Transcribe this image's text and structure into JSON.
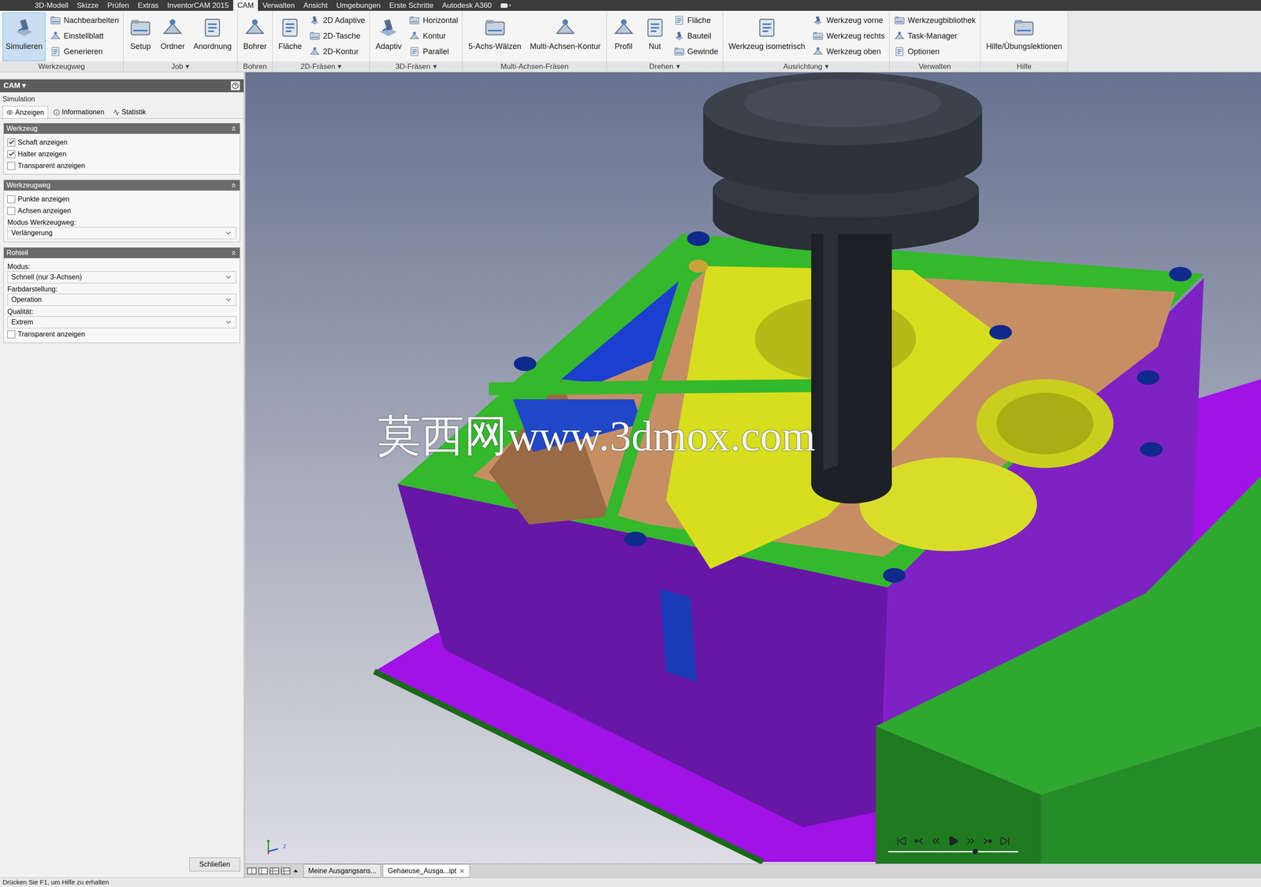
{
  "menu_tabs": [
    {
      "label": "3D-Modell",
      "selected": false
    },
    {
      "label": "Skizze",
      "selected": false
    },
    {
      "label": "Prüfen",
      "selected": false
    },
    {
      "label": "Extras",
      "selected": false
    },
    {
      "label": "InventorCAM 2015",
      "selected": false
    },
    {
      "label": "CAM",
      "selected": true
    },
    {
      "label": "Verwalten",
      "selected": false
    },
    {
      "label": "Ansicht",
      "selected": false
    },
    {
      "label": "Umgebungen",
      "selected": false
    },
    {
      "label": "Erste Schritte",
      "selected": false
    },
    {
      "label": "Autodesk A360",
      "selected": false
    }
  ],
  "dropdown_glyph": "▾",
  "ribbon_groups": [
    {
      "label": "Werkzeugweg",
      "dropdown": false,
      "columns": [
        {
          "kind": "large",
          "items": [
            {
              "label": "Simulieren",
              "selected": true
            }
          ]
        },
        {
          "kind": "stack",
          "items": [
            {
              "label": "Nachbearbeiten",
              "selected": false
            },
            {
              "label": "Einstellblatt",
              "selected": false
            },
            {
              "label": "Generieren",
              "selected": false
            }
          ]
        }
      ]
    },
    {
      "label": "Job",
      "dropdown": true,
      "columns": [
        {
          "kind": "large",
          "items": [
            {
              "label": "Setup",
              "selected": false
            }
          ]
        },
        {
          "kind": "large",
          "items": [
            {
              "label": "Ordner",
              "selected": false
            }
          ]
        },
        {
          "kind": "large",
          "items": [
            {
              "label": "Anordnung",
              "selected": false
            }
          ]
        }
      ]
    },
    {
      "label": "Bohren",
      "dropdown": false,
      "columns": [
        {
          "kind": "large",
          "items": [
            {
              "label": "Bohrer",
              "selected": false
            }
          ]
        }
      ]
    },
    {
      "label": "2D-Fräsen",
      "dropdown": true,
      "columns": [
        {
          "kind": "large",
          "items": [
            {
              "label": "Fläche",
              "selected": false
            }
          ]
        },
        {
          "kind": "stack",
          "items": [
            {
              "label": "2D Adaptive",
              "selected": false
            },
            {
              "label": "2D-Tasche",
              "selected": false
            },
            {
              "label": "2D-Kontur",
              "selected": false
            }
          ]
        }
      ]
    },
    {
      "label": "3D-Fräsen",
      "dropdown": true,
      "columns": [
        {
          "kind": "large",
          "items": [
            {
              "label": "Adaptiv",
              "selected": false
            }
          ]
        },
        {
          "kind": "stack",
          "items": [
            {
              "label": "Horizontal",
              "selected": false
            },
            {
              "label": "Kontur",
              "selected": false
            },
            {
              "label": "Parallel",
              "selected": false
            }
          ]
        }
      ]
    },
    {
      "label": "Multi-Achsen-Fräsen",
      "dropdown": false,
      "columns": [
        {
          "kind": "large",
          "items": [
            {
              "label": "5-Achs-Wälzen",
              "selected": false
            }
          ]
        },
        {
          "kind": "large",
          "items": [
            {
              "label": "Multi-Achsen-Kontur",
              "selected": false
            }
          ]
        }
      ]
    },
    {
      "label": "Drehen",
      "dropdown": true,
      "columns": [
        {
          "kind": "large",
          "items": [
            {
              "label": "Profil",
              "selected": false
            }
          ]
        },
        {
          "kind": "large",
          "items": [
            {
              "label": "Nut",
              "selected": false
            }
          ]
        },
        {
          "kind": "stack",
          "items": [
            {
              "label": "Fläche",
              "selected": false
            },
            {
              "label": "Bauteil",
              "selected": false
            },
            {
              "label": "Gewinde",
              "selected": false
            }
          ]
        }
      ]
    },
    {
      "label": "Ausrichtung",
      "dropdown": true,
      "columns": [
        {
          "kind": "large",
          "items": [
            {
              "label": "Werkzeug isometrisch",
              "selected": false
            }
          ]
        },
        {
          "kind": "stack",
          "items": [
            {
              "label": "Werkzeug vorne",
              "selected": false
            },
            {
              "label": "Werkzeug rechts",
              "selected": false
            },
            {
              "label": "Werkzeug oben",
              "selected": false
            }
          ]
        }
      ]
    },
    {
      "label": "Verwalten",
      "dropdown": false,
      "columns": [
        {
          "kind": "stack",
          "items": [
            {
              "label": "Werkzeugbibliothek",
              "selected": false
            },
            {
              "label": "Task-Manager",
              "selected": false
            },
            {
              "label": "Optionen",
              "selected": false
            }
          ]
        }
      ]
    },
    {
      "label": "Hilfe",
      "dropdown": false,
      "columns": [
        {
          "kind": "large",
          "items": [
            {
              "label": "Hilfe/Übungslektionen",
              "selected": false
            }
          ]
        }
      ]
    }
  ],
  "panel": {
    "title": "CAM",
    "subtitle": "Simulation",
    "tabs": [
      {
        "label": "Anzeigen",
        "selected": true
      },
      {
        "label": "Informationen",
        "selected": false
      },
      {
        "label": "Statistik",
        "selected": false
      }
    ],
    "sections": [
      {
        "title": "Werkzeug",
        "rows": [
          {
            "kind": "checkbox",
            "label": "Schaft anzeigen",
            "checked": true
          },
          {
            "kind": "checkbox",
            "label": "Halter anzeigen",
            "checked": true
          },
          {
            "kind": "checkbox",
            "label": "Transparent anzeigen",
            "checked": false
          }
        ]
      },
      {
        "title": "Werkzeugweg",
        "rows": [
          {
            "kind": "checkbox",
            "label": "Punkte anzeigen",
            "checked": false
          },
          {
            "kind": "checkbox",
            "label": "Achsen anzeigen",
            "checked": false
          },
          {
            "kind": "select",
            "label": "Modus Werkzeugweg:",
            "value": "Verlängerung"
          }
        ]
      },
      {
        "title": "Rohteil",
        "rows": [
          {
            "kind": "select",
            "label": "Modus:",
            "value": "Schnell (nur 3-Achsen)"
          },
          {
            "kind": "select",
            "label": "Farbdarstellung:",
            "value": "Operation"
          },
          {
            "kind": "select",
            "label": "Qualität:",
            "value": "Extrem"
          },
          {
            "kind": "checkbox",
            "label": "Transparent anzeigen",
            "checked": false
          }
        ]
      }
    ],
    "close_button": "Schließen"
  },
  "viewport": {
    "watermark": "莫西网www.3dmox.com",
    "axis_label": "z",
    "playback": {
      "level": 0.67
    }
  },
  "doc_tabs": [
    {
      "label": "Meine Ausgangsans...",
      "selected": false,
      "closable": false
    },
    {
      "label": "Gehaeuse_Ausga...ipt",
      "selected": true,
      "closable": true
    }
  ],
  "status_bar": "Drücken Sie F1, um Hilfe zu erhalten"
}
